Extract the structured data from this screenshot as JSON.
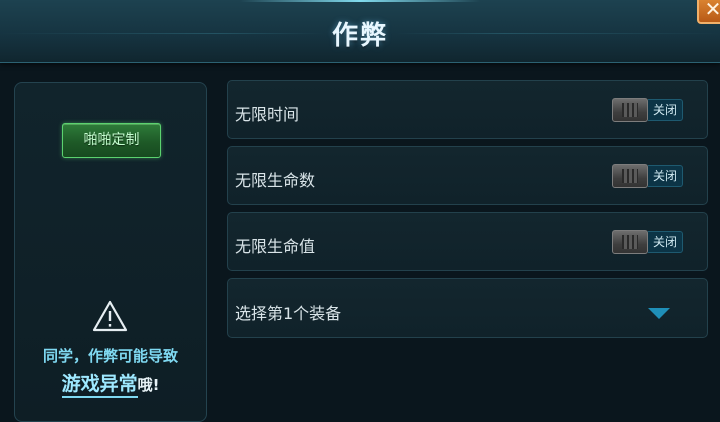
{
  "header": {
    "title": "作弊",
    "close_label": "✕"
  },
  "sidebar": {
    "custom_button_label": "啪啪定制",
    "warning_line1": "同学，作弊可能导致",
    "warning_emphasis": "游戏异常",
    "warning_tail": "哦!"
  },
  "options": [
    {
      "label": "无限时间",
      "state": "关闭"
    },
    {
      "label": "无限生命数",
      "state": "关闭"
    },
    {
      "label": "无限生命值",
      "state": "关闭"
    }
  ],
  "equipment_select": {
    "label": "选择第1个装备"
  },
  "colors": {
    "accent": "#1f8fb8",
    "custom_button": "#2e7c3a",
    "close_button": "#c86a22"
  }
}
